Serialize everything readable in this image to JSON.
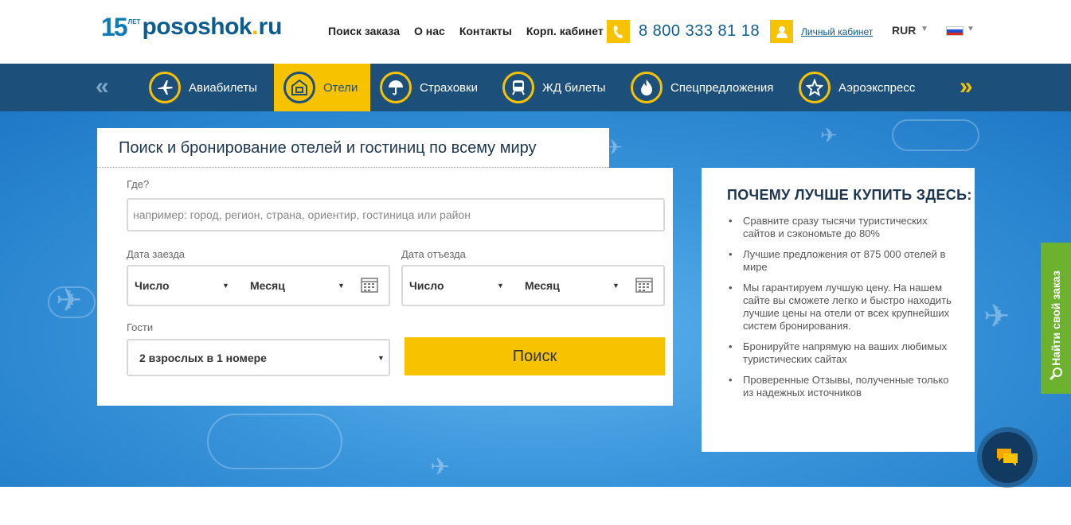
{
  "logo": {
    "years": "15",
    "years_suffix": "ЛЕТ",
    "name": "pososhok",
    "dot": ".",
    "tld": "ru"
  },
  "topnav": [
    "Поиск заказа",
    "О нас",
    "Контакты",
    "Корп. кабинет"
  ],
  "phone": "8 800 333 81 18",
  "cabinet": "Личный кабинет",
  "currency": "RUR",
  "categories": [
    {
      "label": "Авиабилеты",
      "icon": "plane-icon"
    },
    {
      "label": "Отели",
      "icon": "hotel-icon",
      "active": true
    },
    {
      "label": "Страховки",
      "icon": "umbrella-icon"
    },
    {
      "label": "ЖД билеты",
      "icon": "train-icon"
    },
    {
      "label": "Спецпредложения",
      "icon": "fire-icon"
    },
    {
      "label": "Аэроэкспресс",
      "icon": "star-icon"
    }
  ],
  "search": {
    "title": "Поиск и бронирование отелей и гостиниц по всему миру",
    "where_label": "Где?",
    "where_placeholder": "например: город, регион, страна, ориентир, гостиница или район",
    "checkin_label": "Дата заезда",
    "checkout_label": "Дата отъезда",
    "day": "Число",
    "month": "Месяц",
    "guests_label": "Гости",
    "guests_value": "2 взрослых в 1 номере",
    "button": "Поиск"
  },
  "why": {
    "title": "ПОЧЕМУ ЛУЧШЕ КУПИТЬ ЗДЕСЬ:",
    "items": [
      "Сравните сразу тысячи туристических сайтов и сэкономьте до 80%",
      "Лучшие предложения от 875 000 отелей в мире",
      "Мы гарантируем лучшую цену. На нашем сайте вы сможете легко и быстро находить лучшие цены на отели от всех крупнейших систем бронирования.",
      "Бронируйте напрямую на ваших любимых туристических сайтах",
      "Проверенные Отзывы, полученные только из надежных источников"
    ]
  },
  "side_tab": "Найти свой заказ",
  "colors": {
    "accent": "#f7c300",
    "nav": "#1c4f7a",
    "brand": "#0d5c8f",
    "side": "#6db22e"
  }
}
